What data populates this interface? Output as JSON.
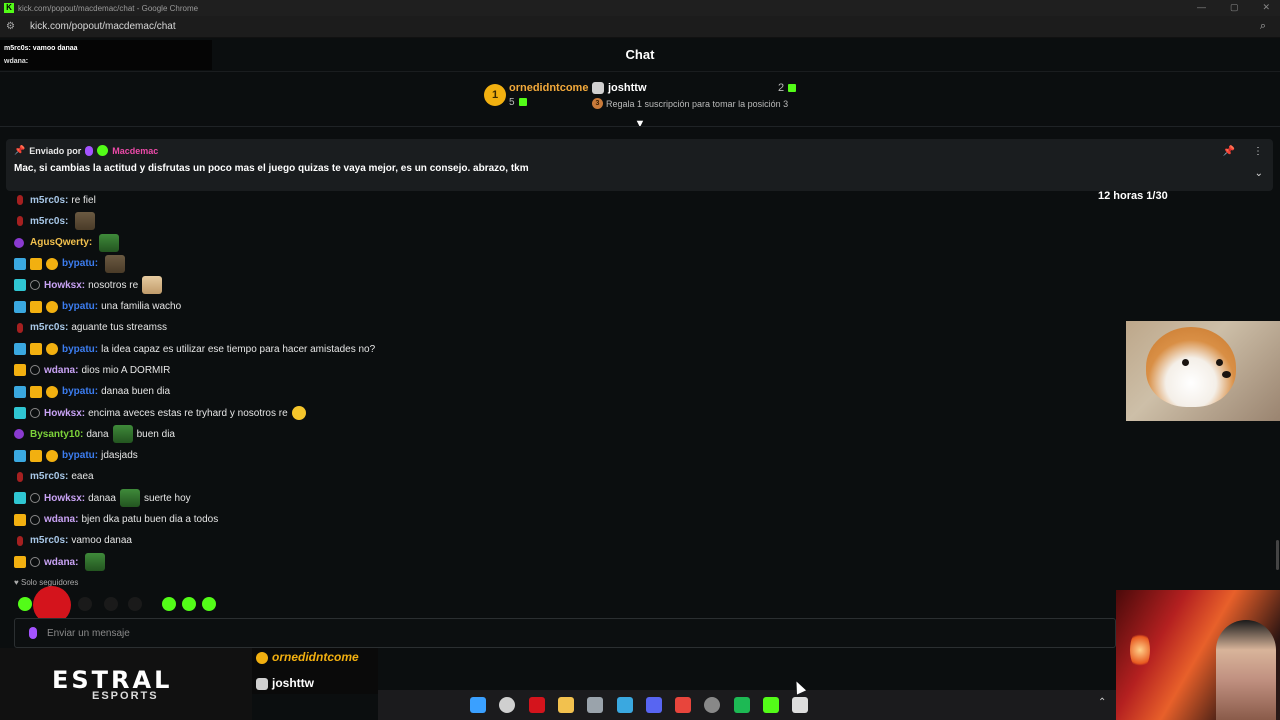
{
  "window": {
    "title": "kick.com/popout/macdemac/chat - Google Chrome",
    "url": "kick.com/popout/macdemac/chat"
  },
  "overlay_chat": [
    {
      "user": "m5rc0s",
      "text": ": vamoo danaa"
    },
    {
      "user": "wdana",
      "text": ":"
    }
  ],
  "header": {
    "title": "Chat"
  },
  "leaderboard": {
    "first": {
      "rank": "1",
      "name": "ornedidntcome",
      "count": "5"
    },
    "second": {
      "name": "joshttw",
      "count": "2"
    },
    "third": {
      "rank": "3",
      "text": "Regala 1 suscripción para tomar la posición 3"
    }
  },
  "pinned": {
    "label": "Enviado por",
    "author": "Macdemac",
    "message": "Mac, si cambias la actitud y disfrutas un poco mas el juego quizas te vaya mejor, es un consejo. abrazo, tkm"
  },
  "timer": {
    "text": "12 horas 1/30"
  },
  "messages": [
    {
      "badges": [
        "mic"
      ],
      "user": "m5rc0s",
      "color": "#a8c8e8",
      "parts": [
        {
          "t": "text",
          "v": "re fiel"
        }
      ]
    },
    {
      "badges": [
        "mic"
      ],
      "user": "m5rc0s",
      "color": "#a8c8e8",
      "parts": [
        {
          "t": "emote",
          "v": "cat"
        }
      ]
    },
    {
      "badges": [
        "ag"
      ],
      "user": "AgusQwerty",
      "color": "#f2c14e",
      "parts": [
        {
          "t": "emote",
          "v": "frog"
        }
      ]
    },
    {
      "badges": [
        "bolt",
        "crown",
        "sub"
      ],
      "user": "bypatu",
      "color": "#3c7df0",
      "parts": [
        {
          "t": "emote",
          "v": "cat"
        }
      ]
    },
    {
      "badges": [
        "grid",
        "ring"
      ],
      "user": "Howksx",
      "color": "#c9a3f5",
      "parts": [
        {
          "t": "text",
          "v": "nosotros re"
        },
        {
          "t": "emote",
          "v": "dog"
        }
      ]
    },
    {
      "badges": [
        "bolt",
        "crown",
        "sub"
      ],
      "user": "bypatu",
      "color": "#3c7df0",
      "parts": [
        {
          "t": "text",
          "v": "una familia wacho"
        }
      ]
    },
    {
      "badges": [
        "mic"
      ],
      "user": "m5rc0s",
      "color": "#a8c8e8",
      "parts": [
        {
          "t": "text",
          "v": "aguante tus streamss"
        }
      ]
    },
    {
      "badges": [
        "bolt",
        "crown",
        "sub"
      ],
      "user": "bypatu",
      "color": "#3c7df0",
      "parts": [
        {
          "t": "text",
          "v": "la idea capaz es utilizar ese tiempo para hacer amistades no?"
        }
      ]
    },
    {
      "badges": [
        "crown",
        "ring"
      ],
      "user": "wdana",
      "color": "#c9a3f5",
      "parts": [
        {
          "t": "text",
          "v": "dios mio A DORMIR"
        }
      ]
    },
    {
      "badges": [
        "bolt",
        "crown",
        "sub"
      ],
      "user": "bypatu",
      "color": "#3c7df0",
      "parts": [
        {
          "t": "text",
          "v": "danaa buen dia"
        }
      ]
    },
    {
      "badges": [
        "grid",
        "ring"
      ],
      "user": "Howksx",
      "color": "#c9a3f5",
      "parts": [
        {
          "t": "text",
          "v": "encima aveces estas re tryhard y nosotros re"
        },
        {
          "t": "emote",
          "v": "smile"
        }
      ]
    },
    {
      "badges": [
        "ag"
      ],
      "user": "Bysanty10",
      "color": "#7dd33a",
      "parts": [
        {
          "t": "text",
          "v": "dana"
        },
        {
          "t": "emote",
          "v": "frog"
        },
        {
          "t": "text",
          "v": "buen dia"
        }
      ]
    },
    {
      "badges": [
        "bolt",
        "crown",
        "sub"
      ],
      "user": "bypatu",
      "color": "#3c7df0",
      "parts": [
        {
          "t": "text",
          "v": "jdasjads"
        }
      ]
    },
    {
      "badges": [
        "mic"
      ],
      "user": "m5rc0s",
      "color": "#a8c8e8",
      "parts": [
        {
          "t": "text",
          "v": "eaea"
        }
      ]
    },
    {
      "badges": [
        "grid",
        "ring"
      ],
      "user": "Howksx",
      "color": "#c9a3f5",
      "parts": [
        {
          "t": "text",
          "v": "danaa"
        },
        {
          "t": "emote",
          "v": "frog"
        },
        {
          "t": "text",
          "v": "suerte hoy"
        }
      ]
    },
    {
      "badges": [
        "crown",
        "ring"
      ],
      "user": "wdana",
      "color": "#c9a3f5",
      "parts": [
        {
          "t": "text",
          "v": "bjen dka patu buen dia a todos"
        }
      ]
    },
    {
      "badges": [
        "mic"
      ],
      "user": "m5rc0s",
      "color": "#a8c8e8",
      "parts": [
        {
          "t": "text",
          "v": "vamoo danaa"
        }
      ]
    },
    {
      "badges": [
        "crown",
        "ring"
      ],
      "user": "wdana",
      "color": "#c9a3f5",
      "parts": [
        {
          "t": "emote",
          "v": "frog"
        }
      ]
    }
  ],
  "footer": {
    "followers_only": "Solo seguidores",
    "input_placeholder": "Enviar un mensaje"
  },
  "branding": {
    "logo_top": "ESTRAL",
    "logo_bottom": "ESPORTS"
  },
  "alerts": [
    {
      "name": "ornedidntcome"
    },
    {
      "name": "joshttw"
    }
  ],
  "taskbar": {
    "icons": [
      "windows-start-icon",
      "search-icon",
      "msi-icon",
      "folder-icon",
      "app-icon",
      "edge-icon",
      "discord-icon",
      "chrome-icon",
      "obs-icon",
      "spotify-icon",
      "kick-icon",
      "browser-icon"
    ]
  }
}
